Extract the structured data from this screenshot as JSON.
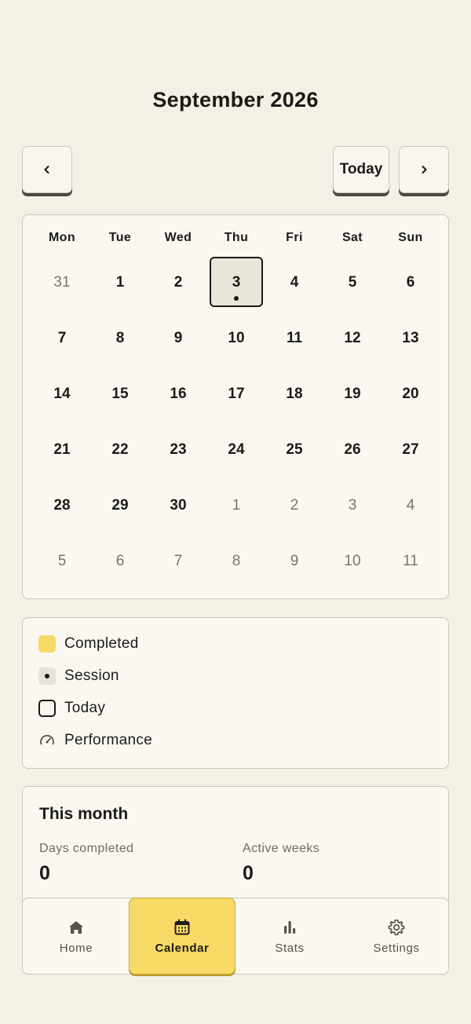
{
  "header": {
    "title": "September 2026"
  },
  "nav": {
    "prev_label": "‹",
    "today_label": "Today",
    "next_label": "›"
  },
  "calendar": {
    "weekdays": [
      "Mon",
      "Tue",
      "Wed",
      "Thu",
      "Fri",
      "Sat",
      "Sun"
    ],
    "today": "3",
    "weeks": [
      [
        {
          "d": "31",
          "out": true
        },
        {
          "d": "1"
        },
        {
          "d": "2"
        },
        {
          "d": "3",
          "today": true,
          "session": true
        },
        {
          "d": "4"
        },
        {
          "d": "5"
        },
        {
          "d": "6"
        }
      ],
      [
        {
          "d": "7"
        },
        {
          "d": "8"
        },
        {
          "d": "9"
        },
        {
          "d": "10"
        },
        {
          "d": "11"
        },
        {
          "d": "12"
        },
        {
          "d": "13"
        }
      ],
      [
        {
          "d": "14"
        },
        {
          "d": "15"
        },
        {
          "d": "16"
        },
        {
          "d": "17"
        },
        {
          "d": "18"
        },
        {
          "d": "19"
        },
        {
          "d": "20"
        }
      ],
      [
        {
          "d": "21"
        },
        {
          "d": "22"
        },
        {
          "d": "23"
        },
        {
          "d": "24"
        },
        {
          "d": "25"
        },
        {
          "d": "26"
        },
        {
          "d": "27"
        }
      ],
      [
        {
          "d": "28"
        },
        {
          "d": "29"
        },
        {
          "d": "30"
        },
        {
          "d": "1",
          "out": true
        },
        {
          "d": "2",
          "out": true
        },
        {
          "d": "3",
          "out": true
        },
        {
          "d": "4",
          "out": true
        }
      ],
      [
        {
          "d": "5",
          "out": true
        },
        {
          "d": "6",
          "out": true
        },
        {
          "d": "7",
          "out": true
        },
        {
          "d": "8",
          "out": true
        },
        {
          "d": "9",
          "out": true
        },
        {
          "d": "10",
          "out": true
        },
        {
          "d": "11",
          "out": true
        }
      ]
    ]
  },
  "legend": {
    "completed": "Completed",
    "session": "Session",
    "today": "Today",
    "performance": "Performance",
    "icons": {
      "performance": "speedometer-icon"
    }
  },
  "month_summary": {
    "title": "This month",
    "days_completed_label": "Days completed",
    "days_completed_value": "0",
    "active_weeks_label": "Active weeks",
    "active_weeks_value": "0"
  },
  "tabs": [
    {
      "label": "Home",
      "icon": "home-icon"
    },
    {
      "label": "Calendar",
      "icon": "calendar-icon",
      "active": true
    },
    {
      "label": "Stats",
      "icon": "bar-chart-icon"
    },
    {
      "label": "Settings",
      "icon": "gear-icon"
    }
  ],
  "colors": {
    "background": "#f3f0e6",
    "card": "#faf8f1",
    "accent": "#f7d965",
    "text": "#1c1b18",
    "muted": "#77756c"
  }
}
